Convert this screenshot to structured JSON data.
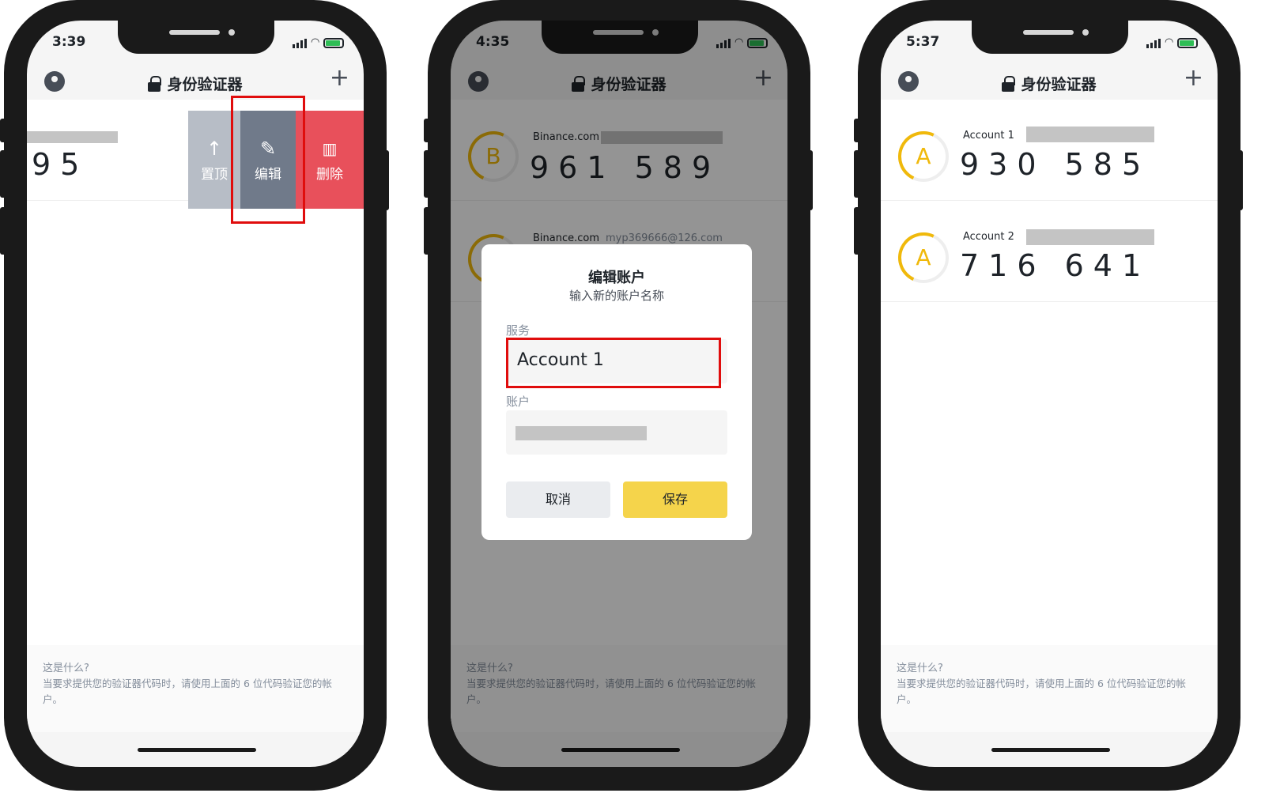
{
  "app": {
    "title": "身份验证器",
    "add_icon": "+",
    "footer_question": "这是什么?",
    "footer_desc": "当要求提供您的验证器代码时，请使用上面的 6 位代码验证您的帐户。"
  },
  "phones": [
    {
      "time": "3:39",
      "partial_code": "95",
      "actions": [
        {
          "label": "置顶",
          "icon": "↑",
          "color": "#b7bdc6"
        },
        {
          "label": "编辑",
          "icon": "✎",
          "color": "#707a8a"
        },
        {
          "label": "删除",
          "icon": "🗑",
          "color": "#e8505b"
        }
      ]
    },
    {
      "time": "4:35",
      "rows": [
        {
          "service": "Binance.com",
          "letter": "B",
          "code": "961 589"
        },
        {
          "service": "Binance.com",
          "account": "myp369666@126.com",
          "letter": "B"
        }
      ],
      "dialog": {
        "title": "编辑账户",
        "subtitle": "输入新的账户名称",
        "service_label": "服务",
        "service_value": "Account 1",
        "account_label": "账户",
        "cancel": "取消",
        "save": "保存"
      }
    },
    {
      "time": "5:37",
      "rows": [
        {
          "name": "Account 1",
          "letter": "A",
          "code": "930 585"
        },
        {
          "name": "Account 2",
          "letter": "A",
          "code": "716 641"
        }
      ]
    }
  ],
  "colors": {
    "brand_yellow": "#f0b90b",
    "save_button": "#f5d44b",
    "highlight_red": "#e00d0d"
  }
}
